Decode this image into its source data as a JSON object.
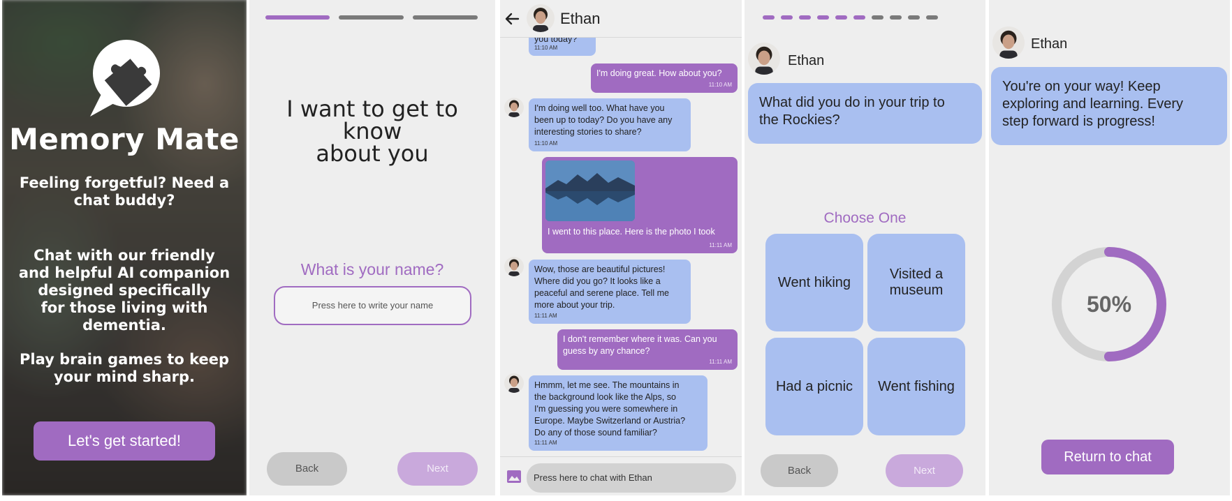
{
  "splash": {
    "app_name": "Memory Mate",
    "intro_lines": [
      "Feeling forgetful? Need a",
      "chat buddy?"
    ],
    "desc_lines": [
      "Chat with our friendly",
      "and helpful AI companion",
      "designed specifically",
      "for those living with",
      "dementia."
    ],
    "games_lines": [
      "Play brain games to keep",
      "your mind sharp."
    ],
    "start_button": "Let's get started!"
  },
  "onboarding": {
    "progress": {
      "total": 3,
      "completed": 1
    },
    "heading_lines": [
      "I want to get to know",
      "about you"
    ],
    "question": "What is your name?",
    "name_placeholder": "Press here to write your name",
    "back": "Back",
    "next": "Next"
  },
  "chat": {
    "contact_name": "Ethan",
    "messages": [
      {
        "from": "ethan",
        "lines": [
          "you today?"
        ],
        "time": "11:10 AM"
      },
      {
        "from": "user",
        "lines": [
          "I'm doing great. How about you?"
        ],
        "time": "11:10 AM"
      },
      {
        "from": "ethan",
        "lines": [
          "I'm doing well too. What have you",
          "been up to today? Do you have any",
          "interesting stories to share?"
        ],
        "time": "11:10 AM"
      },
      {
        "from": "user",
        "lines": [
          "I went to this place. Here is the photo I took"
        ],
        "time": "11:11 AM"
      },
      {
        "from": "ethan",
        "lines": [
          "Wow, those are beautiful pictures!",
          "Where did you go? It looks like a",
          "peaceful and serene place. Tell me",
          "more about your trip."
        ],
        "time": "11:11 AM"
      },
      {
        "from": "user",
        "lines": [
          "I don't remember where it was. Can you",
          "guess by any chance?"
        ],
        "time": "11:11 AM"
      },
      {
        "from": "ethan",
        "lines": [
          "Hmmm, let me see. The mountains in",
          "the background look like the Alps, so",
          "I'm guessing you were somewhere in",
          "Europe. Maybe Switzerland or Austria?",
          "Do any of those sound familiar?"
        ],
        "time": "11:11 AM"
      }
    ],
    "input_placeholder": "Press here to chat with Ethan"
  },
  "quiz": {
    "progress": {
      "total": 10,
      "completed": 6
    },
    "contact_name": "Ethan",
    "question_lines": [
      "What did you do in your trip to",
      "the Rockies?"
    ],
    "prompt": "Choose One",
    "choices": [
      [
        "Went hiking"
      ],
      [
        "Visited a",
        "museum"
      ],
      [
        "Had a picnic"
      ],
      [
        "Went fishing"
      ]
    ],
    "back": "Back",
    "next": "Next"
  },
  "result": {
    "contact_name": "Ethan",
    "message_lines": [
      "You're on your way! Keep",
      "exploring and learning. Every",
      "step forward is progress!"
    ],
    "progress_percent": 50,
    "progress_label": "50%",
    "return_button": "Return to chat"
  },
  "colors": {
    "accent": "#a06bc1",
    "accent_light": "#c9a9dc",
    "bubble_blue": "#a9bff0",
    "inactive": "#7a7a7a"
  }
}
